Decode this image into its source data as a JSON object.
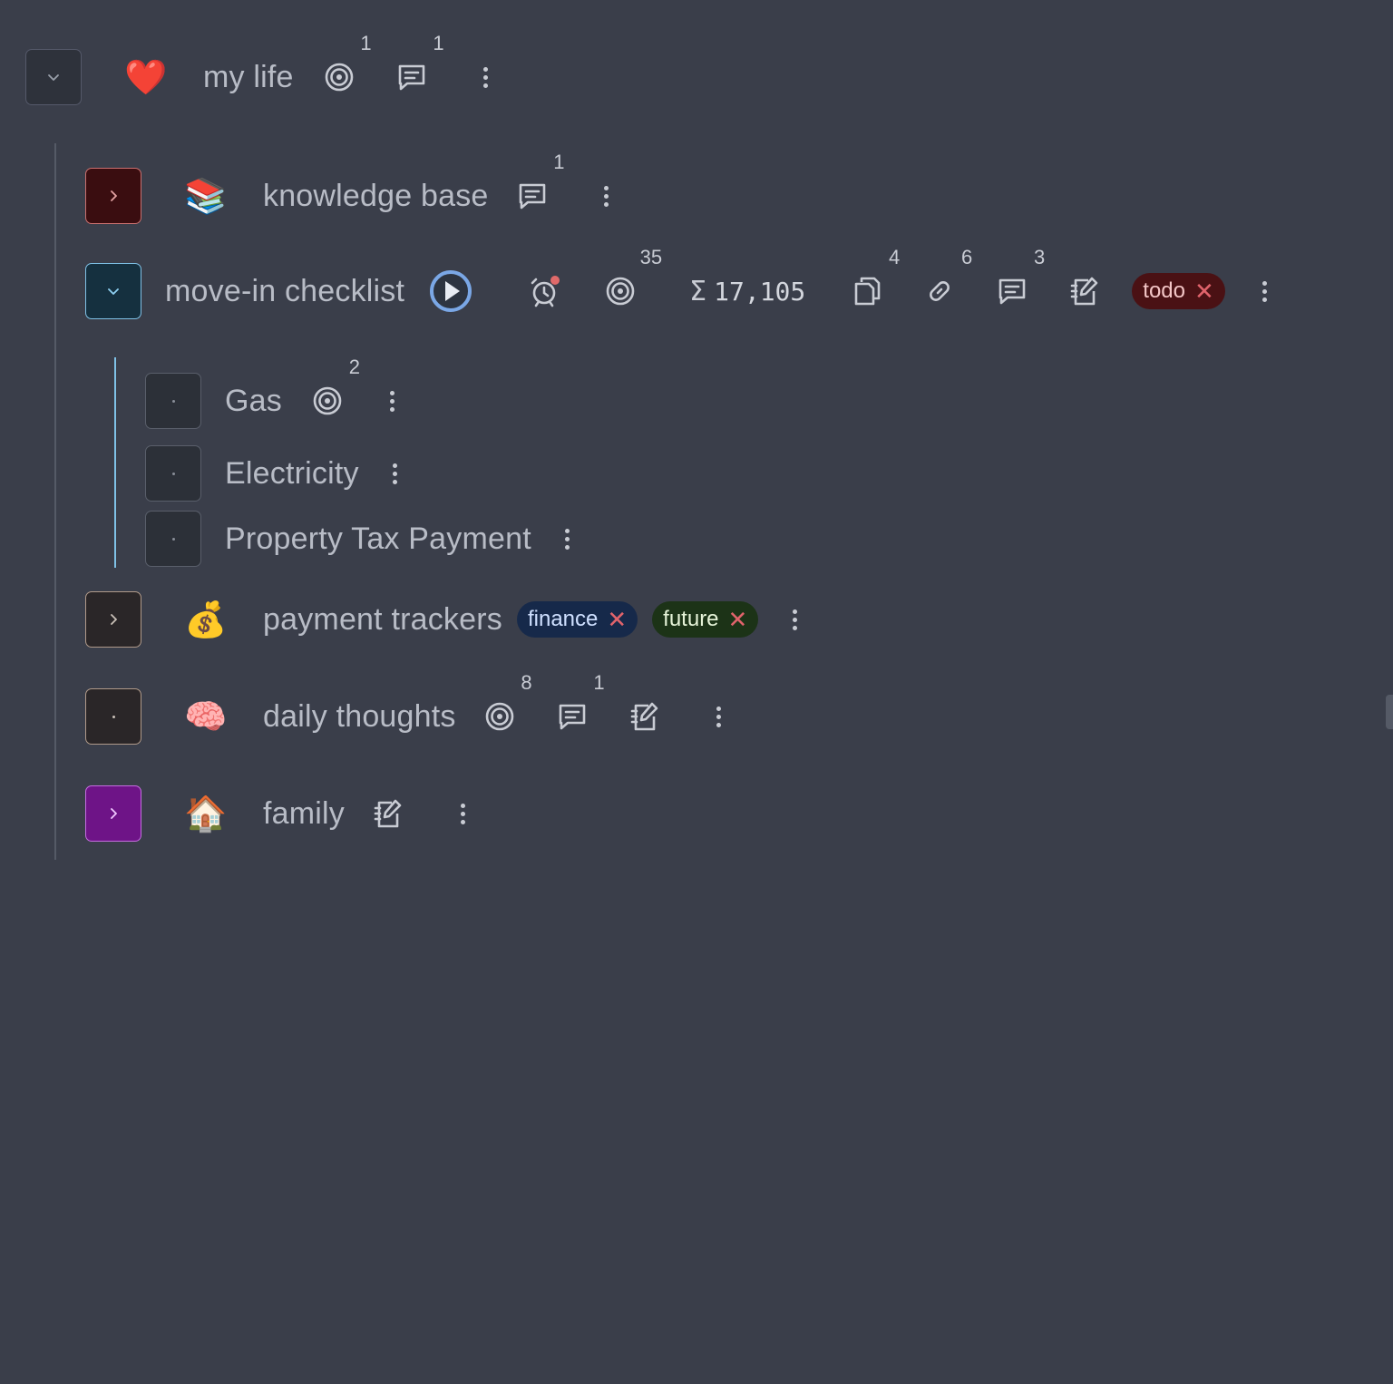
{
  "tree": {
    "root": {
      "emoji": "❤️",
      "title": "my life",
      "goals_count": "1",
      "comments_count": "1"
    },
    "children": [
      {
        "emoji": "📚",
        "title": "knowledge base",
        "comments_count": "1"
      },
      {
        "title": "move-in checklist",
        "goals_count": "35",
        "sum_value": "17,105",
        "files_count": "4",
        "links_count": "6",
        "comments_count": "3",
        "tag": {
          "label": "todo"
        },
        "subitems": [
          {
            "title": "Gas",
            "goals_count": "2"
          },
          {
            "title": "Electricity"
          },
          {
            "title": "Property Tax Payment"
          }
        ]
      },
      {
        "emoji": "💰",
        "title": "payment trackers",
        "tags": [
          {
            "label": "finance"
          },
          {
            "label": "future"
          }
        ]
      },
      {
        "emoji": "🧠",
        "title": "daily thoughts",
        "goals_count": "8",
        "comments_count": "1"
      },
      {
        "emoji": "🏠",
        "title": "family"
      }
    ]
  },
  "colors": {
    "background": "#3a3e4a",
    "knowledge_base_toggle": "#3a0d10",
    "move_in_toggle": "#15303f",
    "family_toggle": "#6e1487",
    "tag_todo": "#4a1114",
    "tag_finance": "#16294a",
    "tag_future": "#1c3317",
    "timer_accent": "#7aa7e6",
    "alarm_dot": "#e06a6a"
  },
  "icons": [
    "chevron-down-icon",
    "chevron-right-icon",
    "target-icon",
    "comment-icon",
    "kebab-menu-icon",
    "play-icon",
    "alarm-icon",
    "sigma-icon",
    "files-icon",
    "link-icon",
    "note-edit-icon",
    "close-icon",
    "dot-icon"
  ]
}
